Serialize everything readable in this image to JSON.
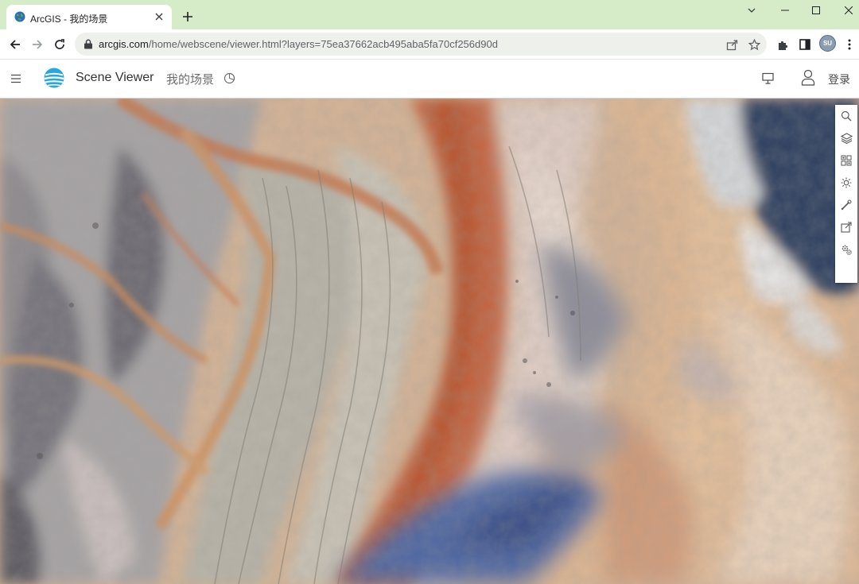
{
  "browser": {
    "tab": {
      "title": "ArcGIS - 我的场景"
    },
    "address": {
      "host": "arcgis.com",
      "path": "/home/webscene/viewer.html?layers=75ea37662acb495aba5fa70cf256d90d"
    },
    "profile_initials": "SU"
  },
  "app": {
    "name": "Scene Viewer",
    "scene_title": "我的场景",
    "sign_in_label": "登录"
  },
  "map": {
    "tools": [
      "search-icon",
      "layers-icon",
      "basemap-gallery-icon",
      "daylight-icon",
      "measure-icon",
      "share-icon",
      "settings-icon"
    ]
  },
  "colors": {
    "tabstrip": "#d6ecc9",
    "accent_logo": "#2aa6df",
    "desert_sand": "#d9b48f",
    "rust_band": "#c1623d",
    "blue_shadow": "#4e6ba6"
  }
}
